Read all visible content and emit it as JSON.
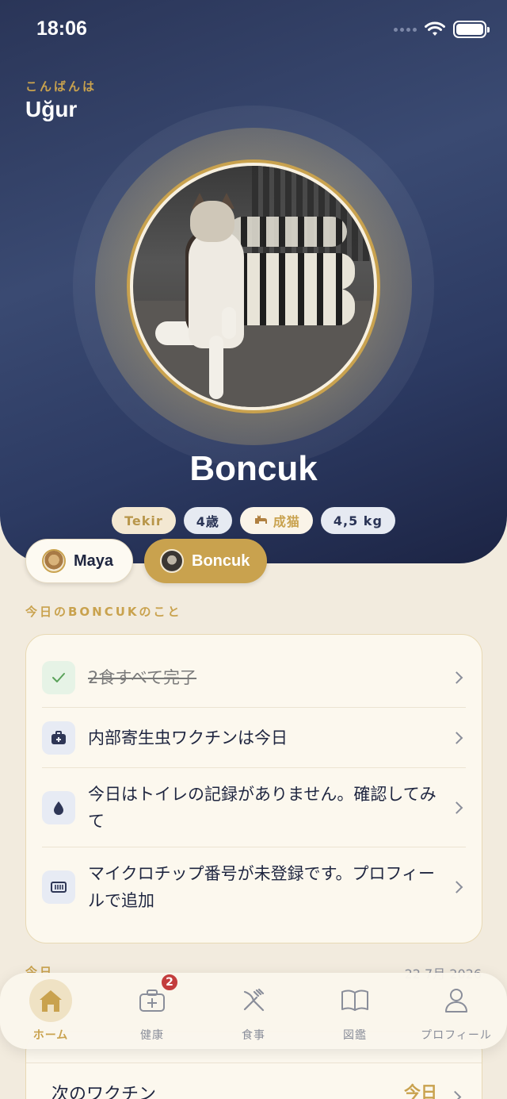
{
  "status_bar": {
    "time": "18:06"
  },
  "header": {
    "greeting": "こんばんは",
    "user_name": "Uğur"
  },
  "pet": {
    "name": "Boncuk",
    "chips": [
      {
        "label": "Tekir"
      },
      {
        "label": "4歳"
      },
      {
        "label": "成猫",
        "icon": "cat-icon"
      },
      {
        "label": "4,5 kg"
      }
    ]
  },
  "pet_switcher": [
    {
      "name": "Maya",
      "selected": false
    },
    {
      "name": "Boncuk",
      "selected": true
    }
  ],
  "today_card": {
    "section_label": "今日のBONCUKのこと",
    "rows": [
      {
        "text": "2食すべて完了",
        "icon": "check-icon",
        "done": true
      },
      {
        "text": "内部寄生虫ワクチンは今日",
        "icon": "medical-bag-icon",
        "done": false
      },
      {
        "text": "今日はトイレの記録がありません。確認してみて",
        "icon": "drop-icon",
        "done": false
      },
      {
        "text": "マイクロチップ番号が未登録です。プロフィールで追加",
        "icon": "microchip-icon",
        "done": false
      }
    ]
  },
  "today_section": {
    "label": "今日",
    "date": "22 7月 2026"
  },
  "next_vaccine": {
    "label": "次のワクチン",
    "value": "今日"
  },
  "tabbar": {
    "tabs": [
      {
        "label": "ホーム",
        "icon": "home-icon",
        "active": true
      },
      {
        "label": "健康",
        "icon": "health-icon",
        "active": false,
        "badge": "2"
      },
      {
        "label": "食事",
        "icon": "fork-knife-icon",
        "active": false
      },
      {
        "label": "図鑑",
        "icon": "book-icon",
        "active": false
      },
      {
        "label": "プロフィール",
        "icon": "person-icon",
        "active": false
      }
    ]
  },
  "colors": {
    "accent_gold": "#c9a24e",
    "hero_navy": "#2c3a62",
    "background_cream": "#f2ebde",
    "badge_red": "#c33d3d"
  }
}
